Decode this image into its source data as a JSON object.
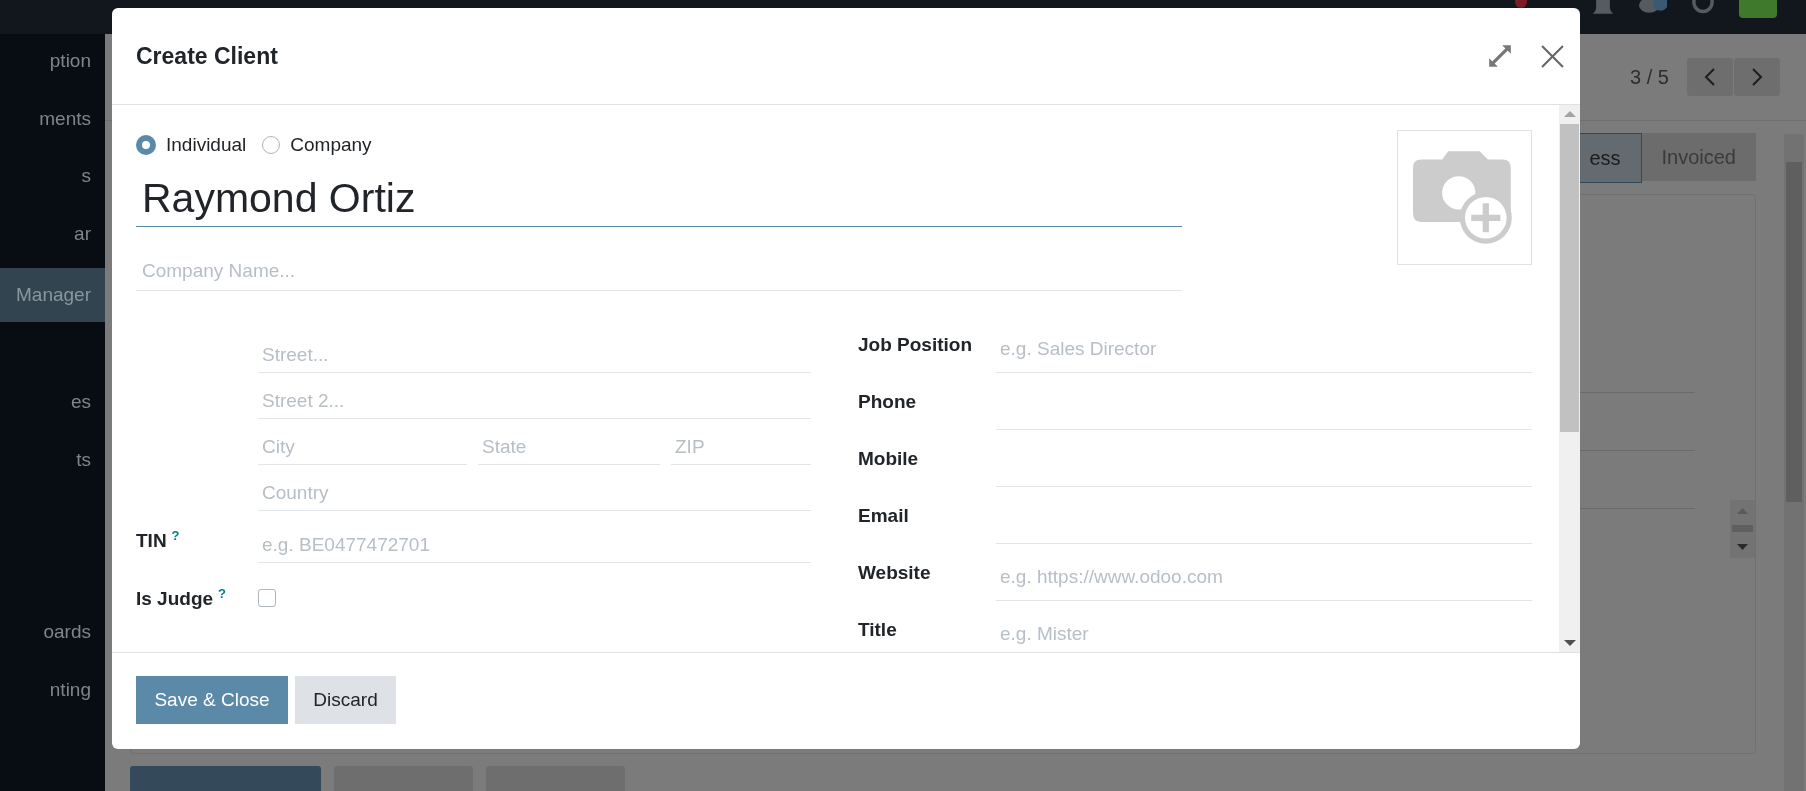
{
  "sidebar": {
    "groups": [
      [
        {
          "label": "ption",
          "selected": false
        },
        {
          "label": "ments",
          "selected": false
        },
        {
          "label": "s",
          "selected": false
        },
        {
          "label": "ar",
          "selected": false
        },
        {
          "label": "Manager",
          "selected": true
        }
      ],
      [
        {
          "label": "es",
          "selected": false
        },
        {
          "label": "ts",
          "selected": false
        }
      ],
      [
        {
          "label": "oards",
          "selected": false
        },
        {
          "label": "nting",
          "selected": false
        }
      ]
    ]
  },
  "record": {
    "pager": "3 / 5",
    "stages": [
      {
        "label": "ess",
        "selected": true
      },
      {
        "label": "Invoiced",
        "selected": false
      }
    ]
  },
  "dialog": {
    "title": "Create Client",
    "type_options": [
      {
        "label": "Individual",
        "selected": true
      },
      {
        "label": "Company",
        "selected": false
      }
    ],
    "name": {
      "value": "Raymond Ortiz"
    },
    "company": {
      "placeholder": "Company Name..."
    },
    "address": {
      "street": {
        "placeholder": "Street..."
      },
      "street2": {
        "placeholder": "Street 2..."
      },
      "city": {
        "placeholder": "City"
      },
      "state": {
        "placeholder": "State"
      },
      "zip": {
        "placeholder": "ZIP"
      },
      "country": {
        "placeholder": "Country"
      }
    },
    "left_fields": [
      {
        "label": "TIN",
        "help": "?",
        "kind": "text",
        "placeholder": "e.g. BE0477472701"
      },
      {
        "label": "Is Judge",
        "help": "?",
        "kind": "checkbox",
        "checked": false
      }
    ],
    "right_fields": [
      {
        "label": "Job Position",
        "placeholder": "e.g. Sales Director"
      },
      {
        "label": "Phone"
      },
      {
        "label": "Mobile"
      },
      {
        "label": "Email"
      },
      {
        "label": "Website",
        "placeholder": "e.g. https://www.odoo.com"
      },
      {
        "label": "Title",
        "placeholder": "e.g. Mister"
      }
    ],
    "buttons": [
      {
        "label": "Save & Close",
        "kind": "primary"
      },
      {
        "label": "Discard",
        "kind": "secondary"
      }
    ]
  }
}
